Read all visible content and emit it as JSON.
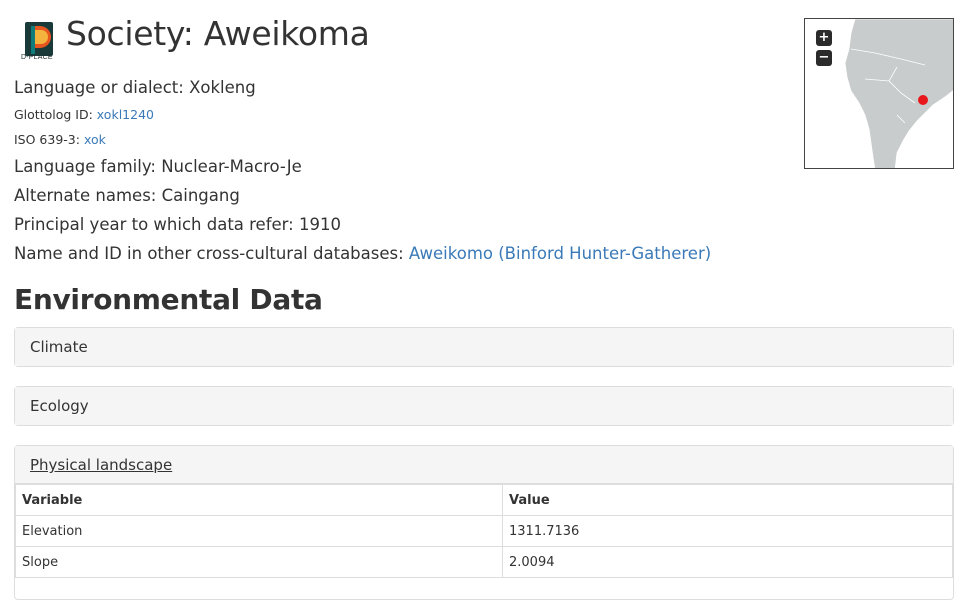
{
  "header": {
    "logo_text": "D-PLACE",
    "title": "Society: Aweikoma"
  },
  "info": {
    "language_label": "Language or dialect:",
    "language_value": "Xokleng",
    "glottolog_label": "Glottolog ID:",
    "glottolog_value": "xokl1240",
    "iso_label": "ISO 639-3:",
    "iso_value": "xok",
    "family_label": "Language family:",
    "family_value": "Nuclear-Macro-Je",
    "alternate_label": "Alternate names:",
    "alternate_value": "Caingang",
    "year_label": "Principal year to which data refer:",
    "year_value": "1910",
    "databases_label": "Name and ID in other cross-cultural databases:",
    "databases_value": "Aweikomo (Binford Hunter-Gatherer)"
  },
  "map": {
    "zoom_in": "+",
    "zoom_out": "−",
    "marker_color": "#e8171b",
    "land_color": "#c8cccc"
  },
  "environmental": {
    "section_title": "Environmental Data",
    "panels": [
      {
        "label": "Climate"
      },
      {
        "label": "Ecology"
      },
      {
        "label": "Physical landscape"
      }
    ],
    "table": {
      "headers": [
        "Variable",
        "Value"
      ],
      "rows": [
        {
          "variable": "Elevation",
          "value": "1311.7136"
        },
        {
          "variable": "Slope",
          "value": "2.0094"
        }
      ]
    }
  }
}
